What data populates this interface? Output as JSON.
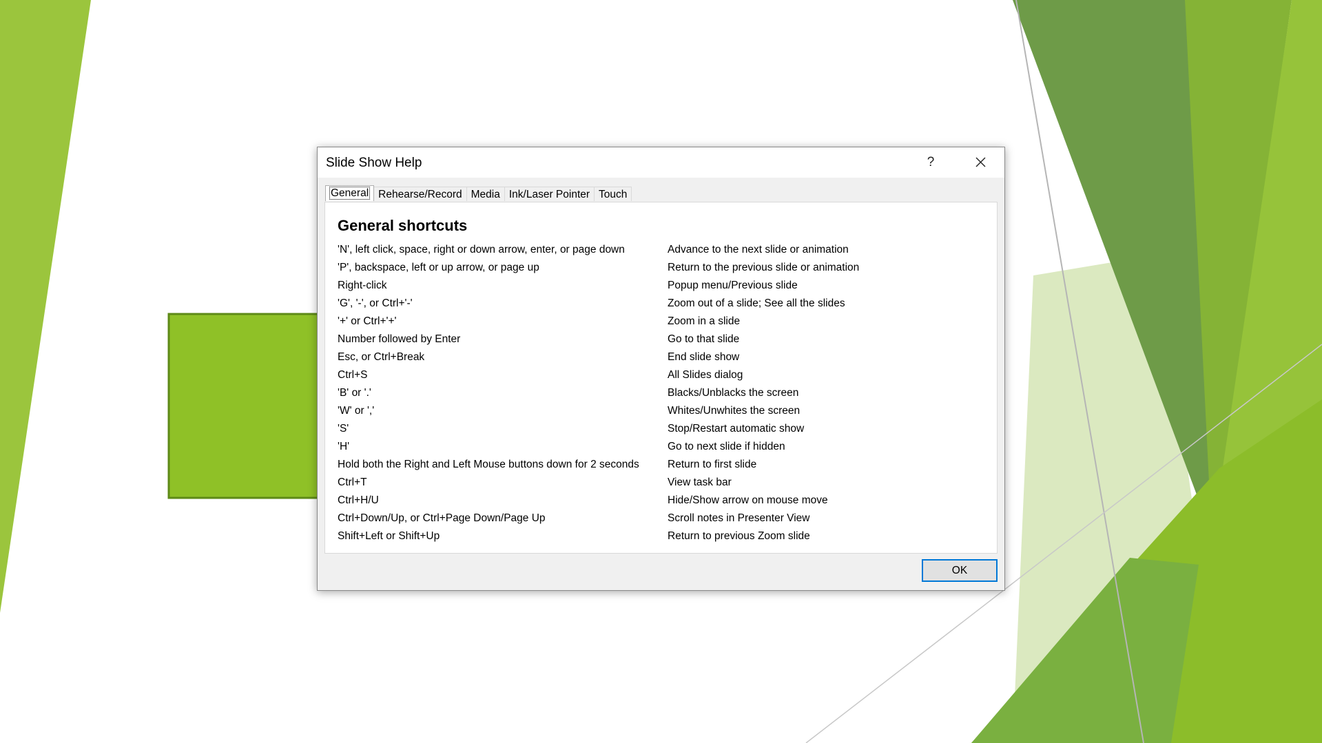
{
  "colors": {
    "slide_green_bright": "#9bc53d",
    "slide_green_mid": "#8cbd2a",
    "slide_green_dark": "#5e8f3a",
    "slide_green_light": "#dbe9c0",
    "rect_fill": "#8fc127",
    "rect_border": "#5e8a17",
    "ok_focus_border": "#0078d7"
  },
  "dialog": {
    "title": "Slide Show Help",
    "help_label": "?",
    "ok_label": "OK",
    "tabs": [
      {
        "label": "General",
        "active": true
      },
      {
        "label": "Rehearse/Record",
        "active": false
      },
      {
        "label": "Media",
        "active": false
      },
      {
        "label": "Ink/Laser Pointer",
        "active": false
      },
      {
        "label": "Touch",
        "active": false
      }
    ],
    "heading": "General shortcuts",
    "shortcuts": [
      {
        "key": "'N', left click, space, right or down arrow, enter, or page down",
        "action": "Advance to the next slide or animation"
      },
      {
        "key": "'P', backspace, left or up arrow, or page up",
        "action": "Return to the previous slide or animation"
      },
      {
        "key": "Right-click",
        "action": "Popup menu/Previous slide"
      },
      {
        "key": "'G', '-', or Ctrl+'-'",
        "action": "Zoom out of a slide; See all the slides"
      },
      {
        "key": "'+' or Ctrl+'+'",
        "action": "Zoom in a slide"
      },
      {
        "key": "Number followed by Enter",
        "action": "Go to that slide"
      },
      {
        "key": "Esc, or Ctrl+Break",
        "action": "End slide show"
      },
      {
        "key": "Ctrl+S",
        "action": "All Slides dialog"
      },
      {
        "key": "'B' or '.'",
        "action": "Blacks/Unblacks the screen"
      },
      {
        "key": "'W' or ','",
        "action": "Whites/Unwhites the screen"
      },
      {
        "key": "'S'",
        "action": "Stop/Restart automatic show"
      },
      {
        "key": "'H'",
        "action": "Go to next slide if hidden"
      },
      {
        "key": "Hold both the Right and Left Mouse buttons down for 2 seconds",
        "action": "Return to first slide"
      },
      {
        "key": "Ctrl+T",
        "action": "View task bar"
      },
      {
        "key": "Ctrl+H/U",
        "action": "Hide/Show arrow on mouse move"
      },
      {
        "key": "Ctrl+Down/Up, or Ctrl+Page Down/Page Up",
        "action": "Scroll notes in Presenter View"
      },
      {
        "key": "Shift+Left or Shift+Up",
        "action": "Return to previous Zoom slide"
      }
    ]
  }
}
